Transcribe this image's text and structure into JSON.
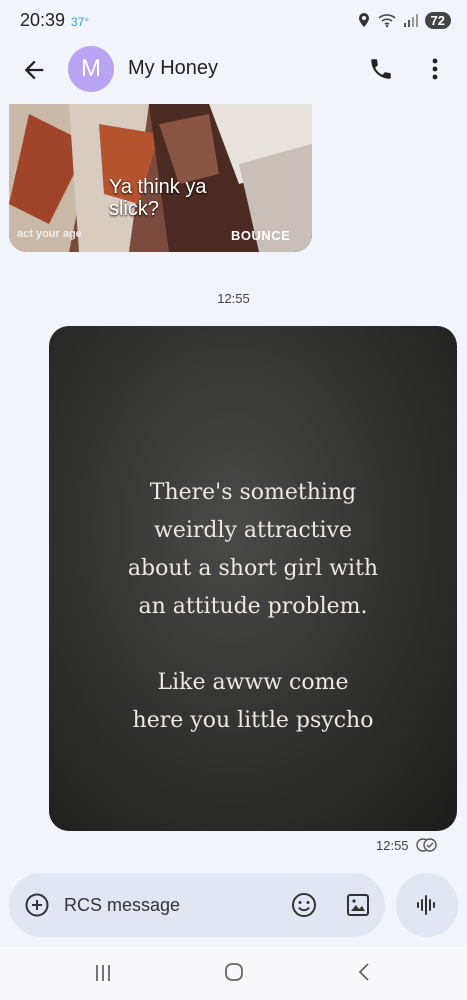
{
  "status_bar": {
    "time": "20:39",
    "temperature": "37°",
    "battery": "72"
  },
  "header": {
    "avatar_letter": "M",
    "contact_name": "My Honey"
  },
  "messages": {
    "gif": {
      "caption": "Ya think ya slick?",
      "logo_left": "act your age",
      "logo_right": "BOUNCE"
    },
    "timestamp_1": "12:55",
    "image": {
      "quote_lines": [
        "There's something",
        "weirdly attractive",
        "about a short girl with",
        "an attitude problem.",
        "",
        "Like awww come",
        "here you little psycho"
      ]
    },
    "timestamp_2": "12:55"
  },
  "composer": {
    "placeholder": "RCS message"
  },
  "colors": {
    "background": "#f2f4fb",
    "avatar": "#b8a4f2",
    "composer": "#e1e6f2"
  }
}
